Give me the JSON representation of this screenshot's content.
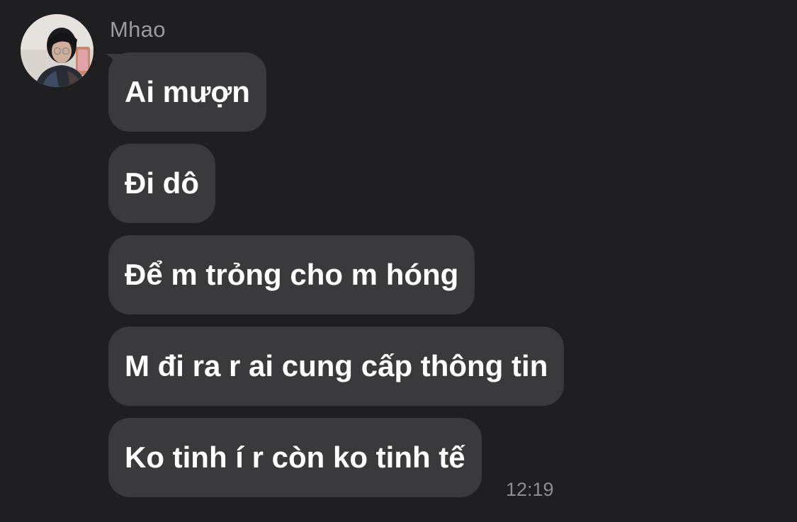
{
  "conversation": {
    "sender_name": "Mhao",
    "avatar_icon": "user-avatar-photo",
    "messages": [
      {
        "text": "Ai mượn"
      },
      {
        "text": "Đi dô"
      },
      {
        "text": "Để m trỏng cho m hóng"
      },
      {
        "text": "M đi ra r ai cung cấp thông tin"
      },
      {
        "text": "Ko tinh í r còn ko tinh tế"
      }
    ],
    "timestamp": "12:19"
  },
  "colors": {
    "background": "#1f1f21",
    "bubble": "#3a3a3c",
    "message_text": "#ffffff",
    "meta_text": "#9b9b9f"
  }
}
